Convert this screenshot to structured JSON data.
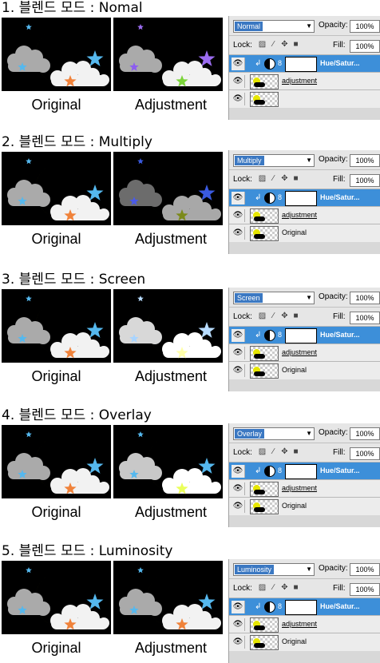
{
  "colors": {
    "panel_bg": "#000000",
    "moon_yellow": "#ffff00",
    "moon_green": "#00ff00",
    "moon_olive": "#a6a600",
    "star_blue": "#55b8ee",
    "star_purple": "#8c5cf0",
    "star_orange": "#f0823a",
    "cloud_gray": "#aaaaaa",
    "cloud_white": "#f2f2f2",
    "selection_blue": "#3d8fd9"
  },
  "sections": [
    {
      "title": "1. 블렌드 모드 : Nomal",
      "left_caption": "Original",
      "right_caption": "Adjustment",
      "blend_mode": "Normal",
      "opacity_label": "Opacity:",
      "opacity_value": "100%",
      "lock_label": "Lock:",
      "fill_label": "Fill:",
      "fill_value": "100%",
      "layers": [
        {
          "name": "Hue/Satur...",
          "selected": true,
          "type": "adjustment"
        },
        {
          "name": "adjustment",
          "selected": false,
          "type": "pixel",
          "underline": true
        },
        {
          "name": "",
          "selected": false,
          "type": "pixel"
        }
      ]
    },
    {
      "title": "2. 블렌드 모드 : Multiply",
      "left_caption": "Original",
      "right_caption": "Adjustment",
      "blend_mode": "Multiply",
      "opacity_label": "Opacity:",
      "opacity_value": "100%",
      "lock_label": "Lock:",
      "fill_label": "Fill:",
      "fill_value": "100%",
      "layers": [
        {
          "name": "Hue/Satur...",
          "selected": true,
          "type": "adjustment"
        },
        {
          "name": "adjustment",
          "selected": false,
          "type": "pixel",
          "underline": true
        },
        {
          "name": "Original",
          "selected": false,
          "type": "pixel"
        }
      ]
    },
    {
      "title": "3. 블렌드 모드 : Screen",
      "left_caption": "Original",
      "right_caption": "Adjustment",
      "blend_mode": "Screen",
      "opacity_label": "Opacity:",
      "opacity_value": "100%",
      "lock_label": "Lock:",
      "fill_label": "Fill:",
      "fill_value": "100%",
      "layers": [
        {
          "name": "Hue/Satur...",
          "selected": true,
          "type": "adjustment"
        },
        {
          "name": "adjustment",
          "selected": false,
          "type": "pixel",
          "underline": true
        },
        {
          "name": "Original",
          "selected": false,
          "type": "pixel"
        }
      ]
    },
    {
      "title": "4. 블렌드 모드 : Overlay",
      "left_caption": "Original",
      "right_caption": "Adjustment",
      "blend_mode": "Overlay",
      "opacity_label": "Opacity:",
      "opacity_value": "100%",
      "lock_label": "Lock:",
      "fill_label": "Fill:",
      "fill_value": "100%",
      "layers": [
        {
          "name": "Hue/Satur...",
          "selected": true,
          "type": "adjustment"
        },
        {
          "name": "adjustment",
          "selected": false,
          "type": "pixel",
          "underline": true
        },
        {
          "name": "Original",
          "selected": false,
          "type": "pixel"
        }
      ]
    },
    {
      "title": "5. 블렌드 모드 : Luminosity",
      "left_caption": "Original",
      "right_caption": "Adjustment",
      "blend_mode": "Luminosity",
      "opacity_label": "Opacity:",
      "opacity_value": "100%",
      "lock_label": "Lock:",
      "fill_label": "Fill:",
      "fill_value": "100%",
      "layers": [
        {
          "name": "Hue/Satur...",
          "selected": true,
          "type": "adjustment"
        },
        {
          "name": "adjustment",
          "selected": false,
          "type": "pixel",
          "underline": true
        },
        {
          "name": "Original",
          "selected": false,
          "type": "pixel"
        }
      ]
    }
  ],
  "icons": {
    "eye": "eye-icon",
    "lock_transparent": "lock-transparent-icon",
    "lock_paint": "brush-icon",
    "lock_move": "move-icon",
    "lock_all": "lock-icon",
    "clip": "clip-arrow-icon",
    "adjustment": "adjustment-circle-icon",
    "chain": "chain-link-icon"
  }
}
